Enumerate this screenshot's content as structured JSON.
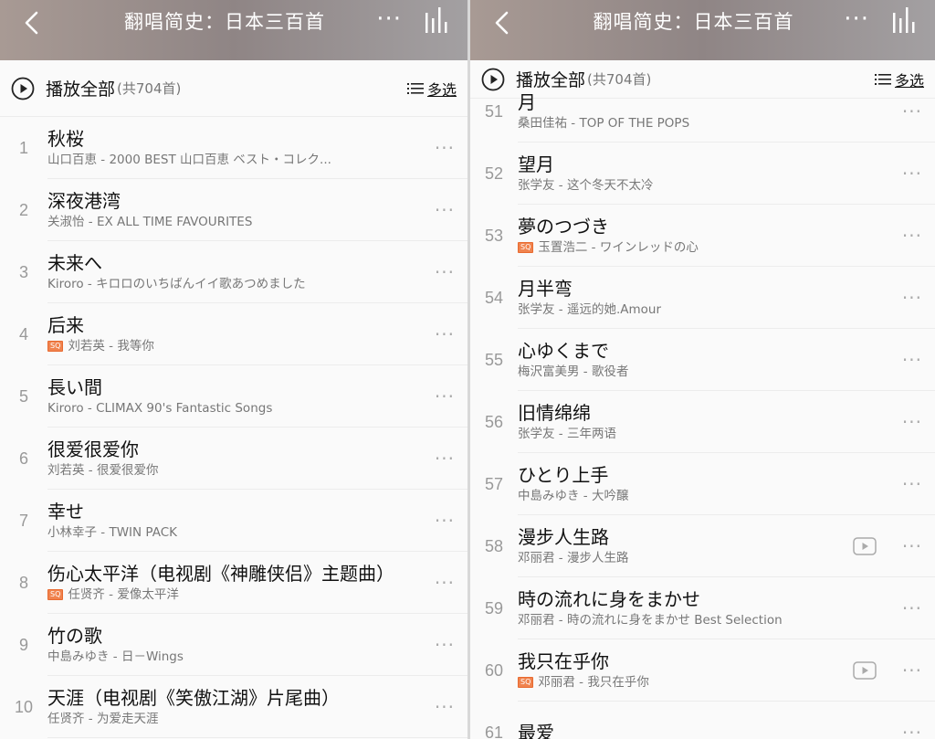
{
  "left": {
    "title": "翻唱简史：日本三百首",
    "play_all": "播放全部",
    "count": "(共704首)",
    "multi": "多选",
    "more": "···",
    "rows": [
      {
        "num": "1",
        "name": "秋桜",
        "sub": "山口百恵 - 2000 BEST 山口百恵 ベスト・コレク...",
        "sq": ""
      },
      {
        "num": "2",
        "name": "深夜港湾",
        "sub": "关淑怡 - EX ALL TIME FAVOURITES",
        "sq": ""
      },
      {
        "num": "3",
        "name": "未来へ",
        "sub": "Kiroro - キロロのいちばんイイ歌あつめました",
        "sq": ""
      },
      {
        "num": "4",
        "name": "后来",
        "sub": "刘若英 - 我等你",
        "sq": "SQ"
      },
      {
        "num": "5",
        "name": "長い間",
        "sub": "Kiroro - CLIMAX 90's Fantastic Songs",
        "sq": ""
      },
      {
        "num": "6",
        "name": "很爱很爱你",
        "sub": "刘若英 - 很爱很爱你",
        "sq": ""
      },
      {
        "num": "7",
        "name": "幸せ",
        "sub": "小林幸子 - TWIN PACK",
        "sq": ""
      },
      {
        "num": "8",
        "name": "伤心太平洋（电视剧《神雕侠侣》主题曲）",
        "sub": "任贤齐 - 爱像太平洋",
        "sq": "SQ"
      },
      {
        "num": "9",
        "name": "竹の歌",
        "sub": "中島みゆき - 日－Wings",
        "sq": ""
      },
      {
        "num": "10",
        "name": "天涯（电视剧《笑傲江湖》片尾曲）",
        "sub": "任贤齐 - 为爱走天涯",
        "sq": ""
      }
    ]
  },
  "right": {
    "title": "翻唱简史：日本三百首",
    "play_all": "播放全部",
    "count": "(共704首)",
    "multi": "多选",
    "more": "···",
    "rows": [
      {
        "num": "51",
        "name": "月",
        "sub": "桑田佳祐 - TOP OF THE POPS",
        "sq": "",
        "mv": false
      },
      {
        "num": "52",
        "name": "望月",
        "sub": "张学友 - 这个冬天不太冷",
        "sq": "",
        "mv": false
      },
      {
        "num": "53",
        "name": "夢のつづき",
        "sub": "玉置浩二 - ワインレッドの心",
        "sq": "SQ",
        "mv": false
      },
      {
        "num": "54",
        "name": "月半弯",
        "sub": "张学友 - 遥远的她.Amour",
        "sq": "",
        "mv": false
      },
      {
        "num": "55",
        "name": "心ゆくまで",
        "sub": "梅沢富美男 - 歌役者",
        "sq": "",
        "mv": false
      },
      {
        "num": "56",
        "name": "旧情绵绵",
        "sub": "张学友 - 三年两语",
        "sq": "",
        "mv": false
      },
      {
        "num": "57",
        "name": "ひとり上手",
        "sub": "中島みゆき - 大吟醸",
        "sq": "",
        "mv": false
      },
      {
        "num": "58",
        "name": "漫步人生路",
        "sub": "邓丽君 - 漫步人生路",
        "sq": "",
        "mv": true
      },
      {
        "num": "59",
        "name": "時の流れに身をまかせ",
        "sub": "邓丽君 - 時の流れに身をまかせ Best Selection",
        "sq": "",
        "mv": false
      },
      {
        "num": "60",
        "name": "我只在乎你",
        "sub": "邓丽君 - 我只在乎你",
        "sq": "SQ",
        "mv": true
      },
      {
        "num": "61",
        "name": "最爱",
        "sub": "",
        "sq": "",
        "mv": false
      }
    ]
  }
}
